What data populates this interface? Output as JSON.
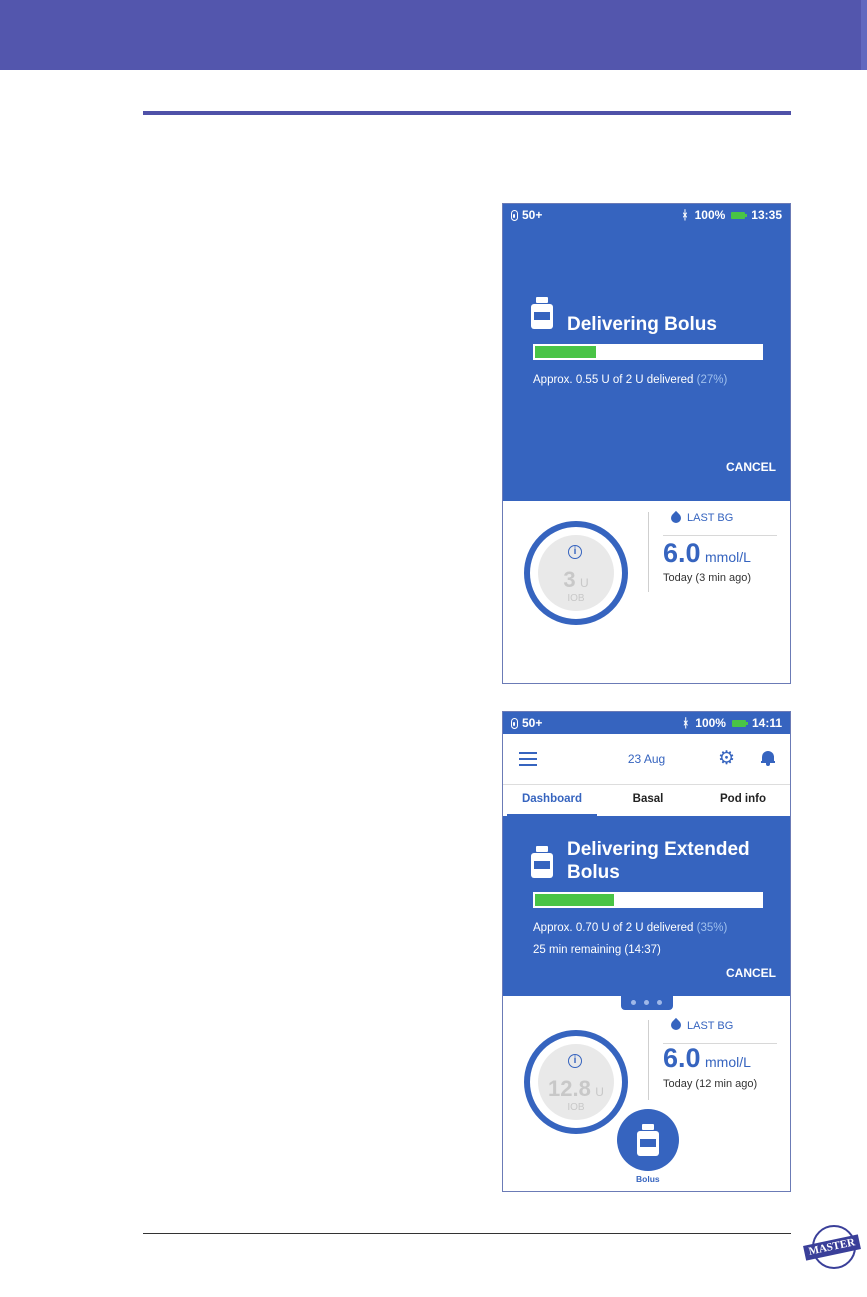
{
  "screen1": {
    "status": {
      "pod": "50+",
      "battery": "100%",
      "time": "13:35"
    },
    "banner": {
      "title": "Delivering Bolus",
      "progress_fraction": 0.27,
      "delivered": "Approx. 0.55 U of 2 U delivered",
      "percent": "(27%)",
      "cancel": "CANCEL"
    },
    "iob": {
      "info": "i",
      "value": "3",
      "unit": "U",
      "label": "IOB"
    },
    "last_bg": {
      "label": "LAST BG",
      "value": "6.0",
      "unit": "mmol/L",
      "time": "Today (3 min ago)"
    }
  },
  "screen2": {
    "status": {
      "pod": "50+",
      "battery": "100%",
      "time": "14:11"
    },
    "appbar": {
      "date": "23 Aug"
    },
    "tabs": [
      "Dashboard",
      "Basal",
      "Pod info"
    ],
    "banner": {
      "title_line1": "Delivering Extended",
      "title_line2": "Bolus",
      "progress_fraction": 0.35,
      "delivered": "Approx. 0.70 U of 2 U delivered",
      "percent": "(35%)",
      "remaining": "25 min remaining (14:37)",
      "cancel": "CANCEL"
    },
    "iob": {
      "info": "i",
      "value": "12.8",
      "unit": "U",
      "label": "IOB"
    },
    "last_bg": {
      "label": "LAST BG",
      "value": "6.0",
      "unit": "mmol/L",
      "time": "Today (12 min ago)"
    },
    "fab": {
      "label": "Bolus"
    }
  },
  "badge": {
    "text": "MASTER"
  },
  "colors": {
    "header": "#5356ad",
    "app_blue": "#3664bf",
    "progress_green": "#49c446"
  },
  "icons": [
    "pod-icon",
    "bluetooth-icon",
    "battery-icon",
    "insulin-bottle-icon",
    "info-icon",
    "blood-drop-icon",
    "menu-icon",
    "gear-icon",
    "bell-icon"
  ]
}
